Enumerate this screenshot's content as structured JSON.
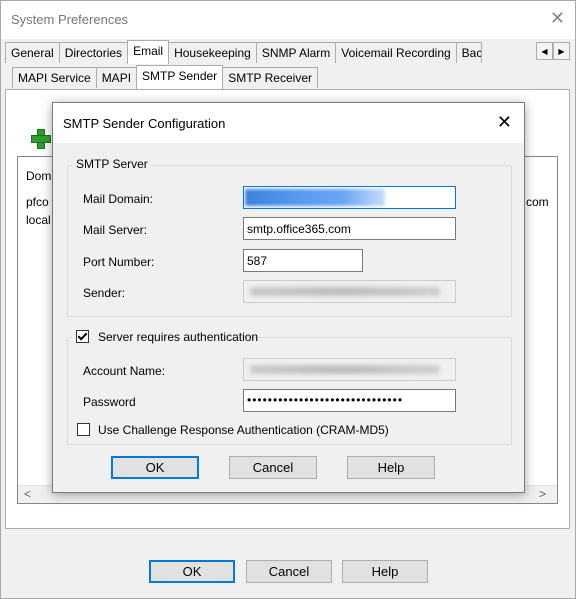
{
  "window": {
    "title": "System Preferences",
    "close_glyph": "✕"
  },
  "tabs_row1": [
    "General",
    "Directories",
    "Email",
    "Housekeeping",
    "SNMP Alarm",
    "Voicemail Recording",
    "Bac"
  ],
  "tabs_row2": [
    "MAPI Service",
    "MAPI",
    "SMTP Sender",
    "SMTP Receiver"
  ],
  "tab_scroll": {
    "left": "◀",
    "right": "▶"
  },
  "list": {
    "col_header_partial": "Dom",
    "row1_partial": "pfco",
    "row2_partial": "local",
    "right_partial": "com"
  },
  "scroll": {
    "left": "<",
    "right": ">"
  },
  "main_buttons": {
    "ok": "OK",
    "cancel": "Cancel",
    "help": "Help"
  },
  "dialog": {
    "title": "SMTP Sender Configuration",
    "close_glyph": "✕",
    "smtp_group": "SMTP Server",
    "mail_domain_label": "Mail Domain:",
    "mail_server_label": "Mail Server:",
    "mail_server_value": "smtp.office365.com",
    "port_label": "Port Number:",
    "port_value": "587",
    "sender_label": "Sender:",
    "auth_checkbox": "Server requires authentication",
    "account_label": "Account Name:",
    "password_label": "Password",
    "password_value": "••••••••••••••••••••••••••••••",
    "cram_checkbox": "Use Challenge Response Authentication (CRAM-MD5)",
    "ok": "OK",
    "cancel": "Cancel",
    "help": "Help"
  },
  "colors": {
    "accent": "#0078d7",
    "add_icon": "#2f9e2f"
  }
}
